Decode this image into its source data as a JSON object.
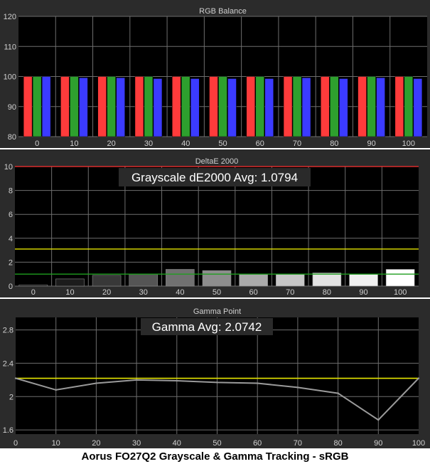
{
  "caption": "Aorus FO27Q2 Grayscale & Gamma Tracking - sRGB",
  "colors": {
    "panel_bg": "#2b2b2b",
    "plot_bg": "#000000",
    "grid": "#6e6e6e",
    "text": "#d0d0d0",
    "red": "#ff3b3b",
    "green": "#2ea02e",
    "blue": "#3b3bff",
    "yellow": "#e6e600",
    "threshold_red": "#ff3030",
    "threshold_green": "#1e9e1e",
    "gamma_line": "#9a9a9a",
    "box_bg": "#2a2a2a",
    "box_text": "#ffffff"
  },
  "chart_data": [
    {
      "type": "bar",
      "title": "RGB Balance",
      "categories": [
        "0",
        "10",
        "20",
        "30",
        "40",
        "50",
        "60",
        "70",
        "80",
        "90",
        "100"
      ],
      "ylim": [
        80,
        120
      ],
      "yticks": [
        "80",
        "90",
        "100",
        "110",
        "120"
      ],
      "grid": true,
      "series": [
        {
          "color_key": "red",
          "values": [
            100,
            100,
            100,
            100,
            100,
            100,
            100,
            100,
            100,
            100,
            100
          ]
        },
        {
          "color_key": "green",
          "values": [
            100,
            100,
            100,
            100,
            100,
            100,
            100,
            100,
            100,
            100,
            100
          ]
        },
        {
          "color_key": "blue",
          "values": [
            100,
            99.6,
            99.6,
            99.3,
            99.3,
            99.3,
            99.3,
            99.6,
            99.3,
            99.6,
            99.3
          ]
        }
      ]
    },
    {
      "type": "bar",
      "title": "DeltaE 2000",
      "annotation": "Grayscale dE2000 Avg: 1.0794",
      "categories": [
        "0",
        "10",
        "20",
        "30",
        "40",
        "50",
        "60",
        "70",
        "80",
        "90",
        "100"
      ],
      "ylim": [
        0,
        10
      ],
      "yticks": [
        "0",
        "2",
        "4",
        "6",
        "8",
        "10"
      ],
      "grid": true,
      "values": [
        0.1,
        0.6,
        0.9,
        1.0,
        1.4,
        1.3,
        1.0,
        1.0,
        1.1,
        1.0,
        1.4
      ],
      "bar_shades": [
        "#000000",
        "#1c1c1c",
        "#383838",
        "#555555",
        "#717171",
        "#8d8d8d",
        "#aaaaaa",
        "#c6c6c6",
        "#e2e2e2",
        "#f0f0f0",
        "#ffffff"
      ],
      "thresholds": [
        {
          "value": 10,
          "color_key": "threshold_red"
        },
        {
          "value": 3.1,
          "color_key": "yellow"
        },
        {
          "value": 1.0,
          "color_key": "threshold_green"
        }
      ]
    },
    {
      "type": "line",
      "title": "Gamma Point",
      "annotation": "Gamma Avg: 2.0742",
      "x": [
        0,
        10,
        20,
        30,
        40,
        50,
        60,
        70,
        80,
        90,
        100
      ],
      "y": [
        2.22,
        2.08,
        2.16,
        2.2,
        2.19,
        2.17,
        2.16,
        2.11,
        2.04,
        1.72,
        2.22
      ],
      "xlim": [
        0,
        100
      ],
      "xticks": [
        "0",
        "10",
        "20",
        "30",
        "40",
        "50",
        "60",
        "70",
        "80",
        "90",
        "100"
      ],
      "ylim": [
        1.55,
        2.95
      ],
      "yticks": [
        "1.6",
        "2",
        "2.4",
        "2.8"
      ],
      "ytick_values": [
        1.6,
        2.0,
        2.4,
        2.8
      ],
      "grid": true,
      "reference": {
        "value": 2.22,
        "color_key": "yellow"
      }
    }
  ]
}
